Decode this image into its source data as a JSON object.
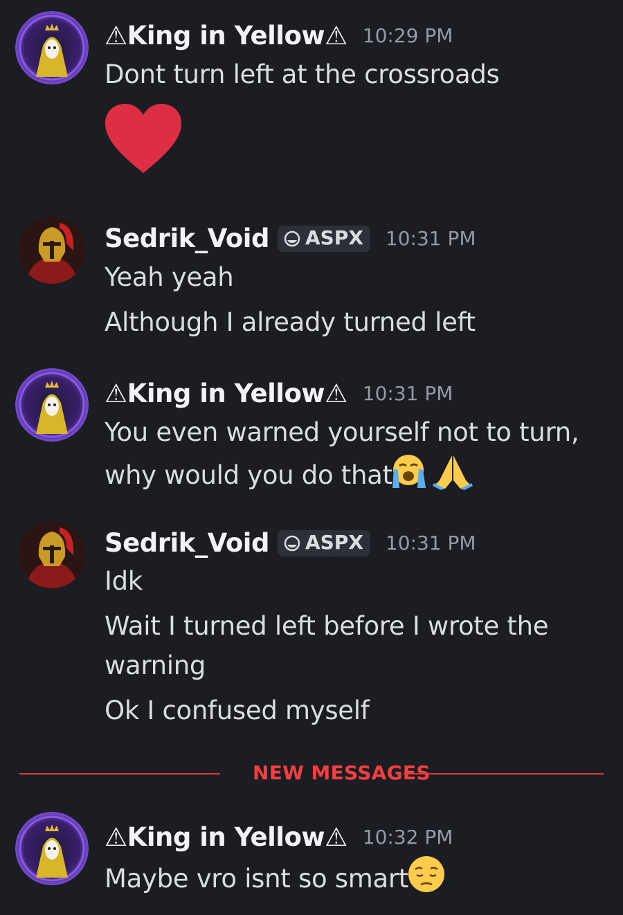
{
  "users": {
    "king": {
      "name": "⚠King in Yellow⚠",
      "avatar_icon": "yellow-hooded-king-avatar"
    },
    "sedrik": {
      "name": "Sedrik_Void",
      "tag": "ASPX",
      "tag_icon": "power-icon",
      "avatar_icon": "golden-spartan-helmet-avatar"
    }
  },
  "messages": [
    {
      "author": "⚠King in Yellow⚠",
      "time": "10:29 PM",
      "lines": [
        "Dont turn left at the crossroads"
      ],
      "emoji": "red-heart"
    },
    {
      "author": "Sedrik_Void",
      "tag": "ASPX",
      "time": "10:31 PM",
      "lines": [
        "Yeah yeah",
        "Although I already turned left"
      ]
    },
    {
      "author": "⚠King in Yellow⚠",
      "time": "10:31 PM",
      "lines": [
        "You even warned yourself not to turn,",
        "why would you do that"
      ],
      "emoji": [
        "loudly-crying-face",
        "folded-hands"
      ]
    },
    {
      "author": "Sedrik_Void",
      "tag": "ASPX",
      "time": "10:31 PM",
      "lines": [
        "Idk",
        "Wait I turned left before I wrote the",
        "warning",
        "Ok I confused myself"
      ]
    },
    {
      "author": "⚠King in Yellow⚠",
      "time": "10:32 PM",
      "lines": [
        "Maybe vro isnt so smart"
      ],
      "emoji": "pensive-face"
    }
  ],
  "divider": {
    "label": "NEW MESSAGES"
  },
  "colors": {
    "background": "#1c1d22",
    "accent_red": "#f23f42",
    "heart": "#dd2e44",
    "emoji_yellow": "#ffcc4d"
  }
}
